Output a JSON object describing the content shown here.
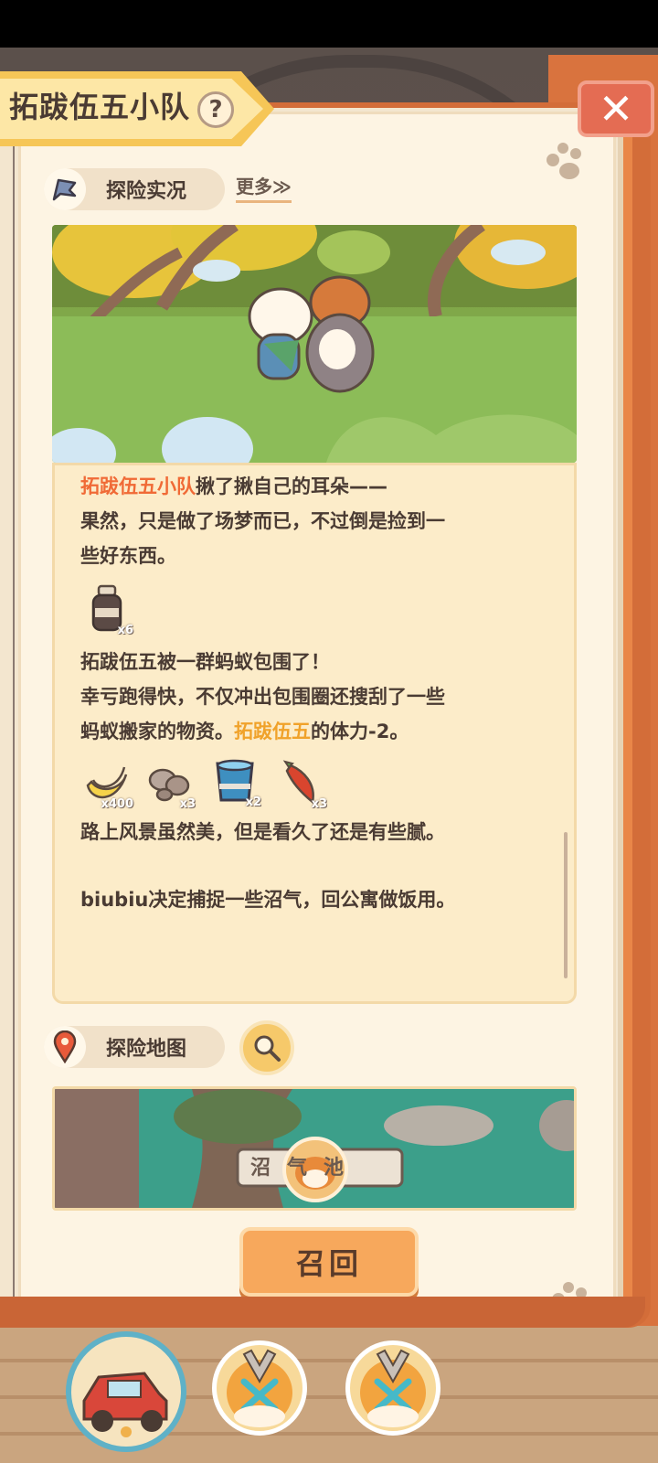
{
  "title": "拓跋伍五小队",
  "help_label": "?",
  "sections": {
    "report_label": "探险实况",
    "more_label": "更多≫",
    "map_label": "探险地图"
  },
  "log": {
    "line1_name": "拓跋伍五小队",
    "line1_rest": "揪了揪自己的耳朵——",
    "line2": "果然，只是做了场梦而已，不过倒是捡到一",
    "line3": "些好东西。",
    "line4": "拓跋伍五被一群蚂蚁包围了！",
    "line5": "幸亏跑得快，不仅冲出包围圈还搜刮了一些",
    "line6_pre": "蚂蚁搬家的物资。",
    "line6_name": "拓跋伍五",
    "line6_post": "的体力-2。",
    "line7": "路上风景虽然美，但是看久了还是有些腻。",
    "line8": "biubiu决定捕捉一些沼气，回公寓做饭用。",
    "items_group1": [
      {
        "icon": "bottle-icon",
        "qty": "x6"
      }
    ],
    "items_group2": [
      {
        "icon": "banana-icon",
        "qty": "x400"
      },
      {
        "icon": "stones-icon",
        "qty": "x3"
      },
      {
        "icon": "water-bucket-icon",
        "qty": "x2"
      },
      {
        "icon": "chili-pepper-icon",
        "qty": "x3"
      }
    ]
  },
  "map": {
    "sign_text": "沼气池"
  },
  "recall_label": "召回",
  "colors": {
    "accent_orange": "#f06a36",
    "highlight_yellow": "#f0a22a",
    "page_bg": "#fdf4e3",
    "book_cover": "#d36d39"
  }
}
